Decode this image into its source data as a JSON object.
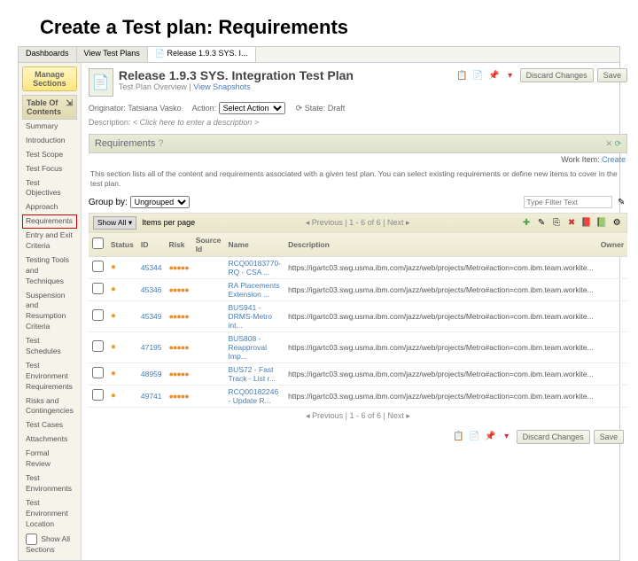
{
  "slide_title": "Create a Test plan: Requirements",
  "tabs": [
    {
      "label": "Dashboards",
      "active": false
    },
    {
      "label": "View Test Plans",
      "active": false
    },
    {
      "label": "Release 1.9.3 SYS. I...",
      "active": true
    }
  ],
  "sidebar": {
    "manage_label": "Manage Sections",
    "toc_label": "Table Of Contents",
    "items": [
      "Summary",
      "Introduction",
      "Test Scope",
      "Test Focus",
      "Test Objectives",
      "Approach",
      "Requirements",
      "Entry and Exit Criteria",
      "Testing Tools and Techniques",
      "Suspension and Resumption Criteria",
      "Test Schedules",
      "Test Environment Requirements",
      "Risks and Contingencies",
      "Test Cases",
      "Attachments",
      "Formal Review",
      "Test Environments",
      "Test Environment Location"
    ],
    "selected_index": 6,
    "show_all_label": "Show All Sections"
  },
  "header": {
    "title": "Release 1.9.3 SYS. Integration Test Plan",
    "subtitle_prefix": "Test Plan Overview",
    "subtitle_link": "View Snapshots",
    "discard_label": "Discard Changes",
    "save_label": "Save"
  },
  "meta": {
    "originator_label": "Originator:",
    "originator_value": "Tatsiana Vasko",
    "action_label": "Action:",
    "action_value": "Select Action",
    "state_label": "State:",
    "state_value": "Draft",
    "description_label": "Description:",
    "description_placeholder": "< Click here to enter a description >"
  },
  "section": {
    "title": "Requirements",
    "desc": "This section lists all of the content and requirements associated with a given test plan. You can select existing requirements or define new items to cover in the test plan.",
    "workitem_label": "Work Item:",
    "workitem_link": "Create"
  },
  "group": {
    "label": "Group by:",
    "value": "Ungrouped",
    "filter_placeholder": "Type Filter Text"
  },
  "toolbar": {
    "show_all": "Show All",
    "items_per_page": "Items per page",
    "prev": "Previous",
    "range": "| 1 - 6 of 6 |",
    "next": "Next"
  },
  "table": {
    "columns": [
      "",
      "Status",
      "ID",
      "Risk",
      "Source Id",
      "Name",
      "Description",
      "Owner"
    ],
    "rows": [
      {
        "id": "45344",
        "name": "RCQ00183770-RQ - CSA ...",
        "desc": "https://igartc03.swg.usma.ibm.com/jazz/web/projects/Metro#action=com.ibm.team.workite..."
      },
      {
        "id": "45346",
        "name": "RA Placements Extension ...",
        "desc": "https://igartc03.swg.usma.ibm.com/jazz/web/projects/Metro#action=com.ibm.team.workite..."
      },
      {
        "id": "45349",
        "name": "BUS941 - DRMS-Metro int...",
        "desc": "https://igartc03.swg.usma.ibm.com/jazz/web/projects/Metro#action=com.ibm.team.workite..."
      },
      {
        "id": "47195",
        "name": "BUS808 - Reapproval Imp...",
        "desc": "https://igartc03.swg.usma.ibm.com/jazz/web/projects/Metro#action=com.ibm.team.workite..."
      },
      {
        "id": "48959",
        "name": "BUS72 - Fast Track - List r...",
        "desc": "https://igartc03.swg.usma.ibm.com/jazz/web/projects/Metro#action=com.ibm.team.workite..."
      },
      {
        "id": "49741",
        "name": "RCQ00182246 - Update R...",
        "desc": "https://igartc03.swg.usma.ibm.com/jazz/web/projects/Metro#action=com.ibm.team.workite..."
      }
    ]
  }
}
